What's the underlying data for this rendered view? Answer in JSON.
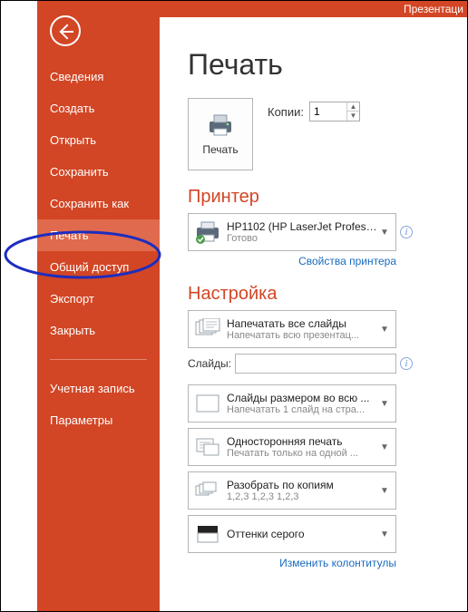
{
  "titlebar": "Презентаци",
  "page_title": "Печать",
  "back_name": "back",
  "sidebar": {
    "items": [
      {
        "label": "Сведения"
      },
      {
        "label": "Создать"
      },
      {
        "label": "Открыть"
      },
      {
        "label": "Сохранить"
      },
      {
        "label": "Сохранить как"
      },
      {
        "label": "Печать",
        "selected": true
      },
      {
        "label": "Общий доступ"
      },
      {
        "label": "Экспорт"
      },
      {
        "label": "Закрыть"
      }
    ],
    "bottom": [
      {
        "label": "Учетная запись"
      },
      {
        "label": "Параметры"
      }
    ]
  },
  "print_button": {
    "label": "Печать"
  },
  "copies": {
    "label": "Копии:",
    "value": "1"
  },
  "printer_section": {
    "title": "Принтер"
  },
  "printer_dd": {
    "line1": "HP1102 (HP LaserJet Professi...",
    "line2": "Готово"
  },
  "printer_props_link": "Свойства принтера",
  "settings_section": {
    "title": "Настройка"
  },
  "settings": [
    {
      "line1": "Напечатать все слайды",
      "line2": "Напечатать всю презентац...",
      "icon": "slides-all-icon"
    },
    {
      "line1": "Слайды размером во всю ...",
      "line2": "Напечатать 1 слайд на стра...",
      "icon": "slide-full-icon"
    },
    {
      "line1": "Односторонняя печать",
      "line2": "Печатать только на одной ...",
      "icon": "one-side-icon"
    },
    {
      "line1": "Разобрать по копиям",
      "line2": "1,2,3    1,2,3    1,2,3",
      "icon": "collate-icon"
    },
    {
      "line1": "Оттенки серого",
      "line2": "",
      "icon": "grayscale-icon"
    }
  ],
  "slides_label": "Слайды:",
  "slides_value": "",
  "footer_link": "Изменить колонтитулы"
}
